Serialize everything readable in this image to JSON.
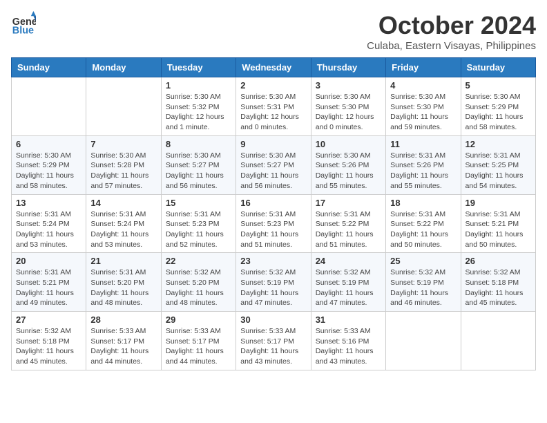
{
  "header": {
    "logo_general": "General",
    "logo_blue": "Blue",
    "month": "October 2024",
    "location": "Culaba, Eastern Visayas, Philippines"
  },
  "weekdays": [
    "Sunday",
    "Monday",
    "Tuesday",
    "Wednesday",
    "Thursday",
    "Friday",
    "Saturday"
  ],
  "weeks": [
    [
      {
        "day": "",
        "info": ""
      },
      {
        "day": "",
        "info": ""
      },
      {
        "day": "1",
        "info": "Sunrise: 5:30 AM\nSunset: 5:32 PM\nDaylight: 12 hours\nand 1 minute."
      },
      {
        "day": "2",
        "info": "Sunrise: 5:30 AM\nSunset: 5:31 PM\nDaylight: 12 hours\nand 0 minutes."
      },
      {
        "day": "3",
        "info": "Sunrise: 5:30 AM\nSunset: 5:30 PM\nDaylight: 12 hours\nand 0 minutes."
      },
      {
        "day": "4",
        "info": "Sunrise: 5:30 AM\nSunset: 5:30 PM\nDaylight: 11 hours\nand 59 minutes."
      },
      {
        "day": "5",
        "info": "Sunrise: 5:30 AM\nSunset: 5:29 PM\nDaylight: 11 hours\nand 58 minutes."
      }
    ],
    [
      {
        "day": "6",
        "info": "Sunrise: 5:30 AM\nSunset: 5:29 PM\nDaylight: 11 hours\nand 58 minutes."
      },
      {
        "day": "7",
        "info": "Sunrise: 5:30 AM\nSunset: 5:28 PM\nDaylight: 11 hours\nand 57 minutes."
      },
      {
        "day": "8",
        "info": "Sunrise: 5:30 AM\nSunset: 5:27 PM\nDaylight: 11 hours\nand 56 minutes."
      },
      {
        "day": "9",
        "info": "Sunrise: 5:30 AM\nSunset: 5:27 PM\nDaylight: 11 hours\nand 56 minutes."
      },
      {
        "day": "10",
        "info": "Sunrise: 5:30 AM\nSunset: 5:26 PM\nDaylight: 11 hours\nand 55 minutes."
      },
      {
        "day": "11",
        "info": "Sunrise: 5:31 AM\nSunset: 5:26 PM\nDaylight: 11 hours\nand 55 minutes."
      },
      {
        "day": "12",
        "info": "Sunrise: 5:31 AM\nSunset: 5:25 PM\nDaylight: 11 hours\nand 54 minutes."
      }
    ],
    [
      {
        "day": "13",
        "info": "Sunrise: 5:31 AM\nSunset: 5:24 PM\nDaylight: 11 hours\nand 53 minutes."
      },
      {
        "day": "14",
        "info": "Sunrise: 5:31 AM\nSunset: 5:24 PM\nDaylight: 11 hours\nand 53 minutes."
      },
      {
        "day": "15",
        "info": "Sunrise: 5:31 AM\nSunset: 5:23 PM\nDaylight: 11 hours\nand 52 minutes."
      },
      {
        "day": "16",
        "info": "Sunrise: 5:31 AM\nSunset: 5:23 PM\nDaylight: 11 hours\nand 51 minutes."
      },
      {
        "day": "17",
        "info": "Sunrise: 5:31 AM\nSunset: 5:22 PM\nDaylight: 11 hours\nand 51 minutes."
      },
      {
        "day": "18",
        "info": "Sunrise: 5:31 AM\nSunset: 5:22 PM\nDaylight: 11 hours\nand 50 minutes."
      },
      {
        "day": "19",
        "info": "Sunrise: 5:31 AM\nSunset: 5:21 PM\nDaylight: 11 hours\nand 50 minutes."
      }
    ],
    [
      {
        "day": "20",
        "info": "Sunrise: 5:31 AM\nSunset: 5:21 PM\nDaylight: 11 hours\nand 49 minutes."
      },
      {
        "day": "21",
        "info": "Sunrise: 5:31 AM\nSunset: 5:20 PM\nDaylight: 11 hours\nand 48 minutes."
      },
      {
        "day": "22",
        "info": "Sunrise: 5:32 AM\nSunset: 5:20 PM\nDaylight: 11 hours\nand 48 minutes."
      },
      {
        "day": "23",
        "info": "Sunrise: 5:32 AM\nSunset: 5:19 PM\nDaylight: 11 hours\nand 47 minutes."
      },
      {
        "day": "24",
        "info": "Sunrise: 5:32 AM\nSunset: 5:19 PM\nDaylight: 11 hours\nand 47 minutes."
      },
      {
        "day": "25",
        "info": "Sunrise: 5:32 AM\nSunset: 5:19 PM\nDaylight: 11 hours\nand 46 minutes."
      },
      {
        "day": "26",
        "info": "Sunrise: 5:32 AM\nSunset: 5:18 PM\nDaylight: 11 hours\nand 45 minutes."
      }
    ],
    [
      {
        "day": "27",
        "info": "Sunrise: 5:32 AM\nSunset: 5:18 PM\nDaylight: 11 hours\nand 45 minutes."
      },
      {
        "day": "28",
        "info": "Sunrise: 5:33 AM\nSunset: 5:17 PM\nDaylight: 11 hours\nand 44 minutes."
      },
      {
        "day": "29",
        "info": "Sunrise: 5:33 AM\nSunset: 5:17 PM\nDaylight: 11 hours\nand 44 minutes."
      },
      {
        "day": "30",
        "info": "Sunrise: 5:33 AM\nSunset: 5:17 PM\nDaylight: 11 hours\nand 43 minutes."
      },
      {
        "day": "31",
        "info": "Sunrise: 5:33 AM\nSunset: 5:16 PM\nDaylight: 11 hours\nand 43 minutes."
      },
      {
        "day": "",
        "info": ""
      },
      {
        "day": "",
        "info": ""
      }
    ]
  ]
}
